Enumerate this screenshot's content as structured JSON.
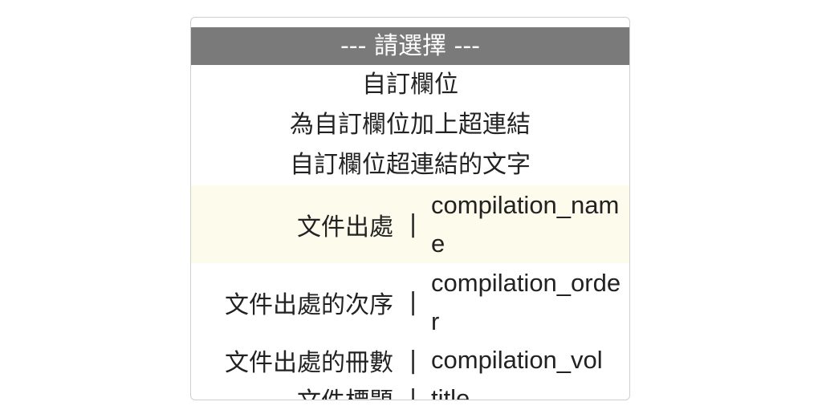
{
  "dropdown": {
    "header": "--- 請選擇 ---",
    "simple_items": [
      "自訂欄位",
      "為自訂欄位加上超連結",
      "自訂欄位超連結的文字"
    ],
    "separator": "|",
    "pair_items": [
      {
        "label": "文件出處",
        "field": "compilation_name",
        "highlighted": true
      },
      {
        "label": "文件出處的次序",
        "field": "compilation_order",
        "highlighted": false
      },
      {
        "label": "文件出處的冊數",
        "field": "compilation_vol",
        "highlighted": false
      },
      {
        "label": "文件標題",
        "field": "title",
        "highlighted": false
      }
    ]
  },
  "colors": {
    "header_bg": "#7a7a7a",
    "highlight_bg": "#fcfbec",
    "text": "#222222"
  }
}
